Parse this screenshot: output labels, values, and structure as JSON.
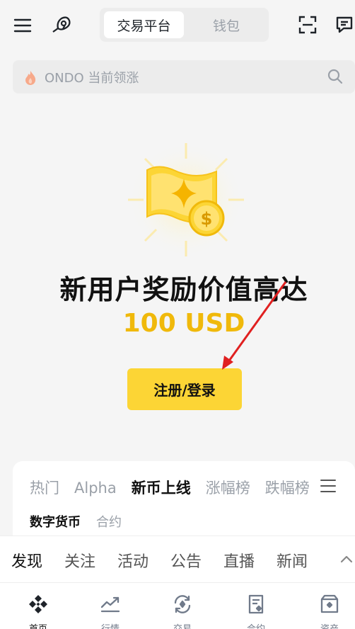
{
  "header": {
    "tabs": [
      {
        "label": "交易平台",
        "active": true
      },
      {
        "label": "钱包",
        "active": false
      }
    ],
    "icons": [
      "menu-icon",
      "support-icon",
      "scan-icon",
      "message-icon"
    ]
  },
  "search": {
    "icon": "fire-icon",
    "placeholder": "ONDO 当前领涨"
  },
  "promo": {
    "headline": "新用户奖励价值高达",
    "amount": "100 USD",
    "button": "注册/登录",
    "accent": "#f0b90b",
    "button_color": "#fcd535"
  },
  "market": {
    "tabs": [
      "热门",
      "Alpha",
      "新币上线",
      "涨幅榜",
      "跌幅榜"
    ],
    "active_tab": "新币上线",
    "subtabs": [
      "数字货币",
      "合约"
    ],
    "active_subtab": "数字货币"
  },
  "feed": {
    "tabs": [
      "发现",
      "关注",
      "活动",
      "公告",
      "直播",
      "新闻"
    ],
    "active": "发现"
  },
  "bottom_nav": [
    {
      "label": "首页",
      "icon": "home-icon",
      "active": true
    },
    {
      "label": "行情",
      "icon": "markets-icon",
      "active": false
    },
    {
      "label": "交易",
      "icon": "trade-icon",
      "active": false
    },
    {
      "label": "合约",
      "icon": "futures-icon",
      "active": false
    },
    {
      "label": "资产",
      "icon": "assets-icon",
      "active": false
    }
  ]
}
